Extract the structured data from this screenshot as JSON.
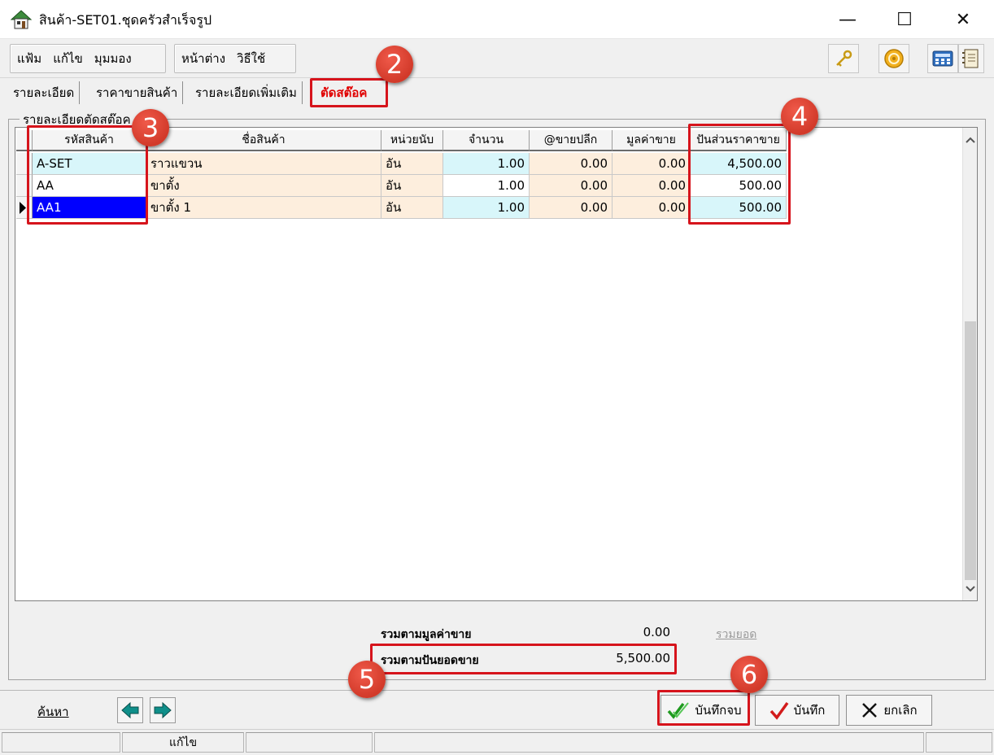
{
  "window": {
    "title": "สินค้า-SET01.ชุดครัวสำเร็จรูป",
    "minimize": "—",
    "maximize": "☐",
    "close": "✕"
  },
  "menu": {
    "items": [
      "แฟ้ม",
      "แก้ไข",
      "มุมมอง"
    ],
    "items2": [
      "หน้าต่าง",
      "วิธีใช้"
    ]
  },
  "tabs": [
    "รายละเอียด",
    "ราคาขายสินค้า",
    "รายละเอียดเพิ่มเติม",
    "ตัดสต๊อค"
  ],
  "group_title": "รายละเอียดตัดสต๊อค",
  "grid": {
    "headers": [
      "รหัสสินค้า",
      "ชื่อสินค้า",
      "หน่วยนับ",
      "จำนวน",
      "@ขายปลีก",
      "มูลค่าขาย",
      "ปันส่วนราคาขาย"
    ],
    "rows": [
      {
        "code": "A-SET",
        "name": "ราวแขวน",
        "unit": "อัน",
        "qty": "1.00",
        "price": "0.00",
        "value": "0.00",
        "alloc": "4,500.00"
      },
      {
        "code": "AA",
        "name": "ขาตั้ง",
        "unit": "อัน",
        "qty": "1.00",
        "price": "0.00",
        "value": "0.00",
        "alloc": "500.00"
      },
      {
        "code": "AA1",
        "name": "ขาตั้ง 1",
        "unit": "อัน",
        "qty": "1.00",
        "price": "0.00",
        "value": "0.00",
        "alloc": "500.00"
      }
    ]
  },
  "totals": {
    "by_value_label": "รวมตามมูลค่าขาย",
    "by_value": "0.00",
    "by_alloc_label": "รวมตามปันยอดขาย",
    "by_alloc": "5,500.00",
    "sum_link": "รวมยอด"
  },
  "bottom": {
    "search": "ค้นหา",
    "save_close": "บันทึกจบ",
    "save": "บันทึก",
    "cancel": "ยกเลิก"
  },
  "status": {
    "mode": "แก้ไข"
  },
  "badges": [
    "2",
    "3",
    "4",
    "5",
    "6"
  ],
  "colors": {
    "annotation_red": "#d6141c",
    "selected_cell": "#0000ff",
    "cyan_cell": "#d8f6fa",
    "peach_cell": "#fdeedd"
  }
}
